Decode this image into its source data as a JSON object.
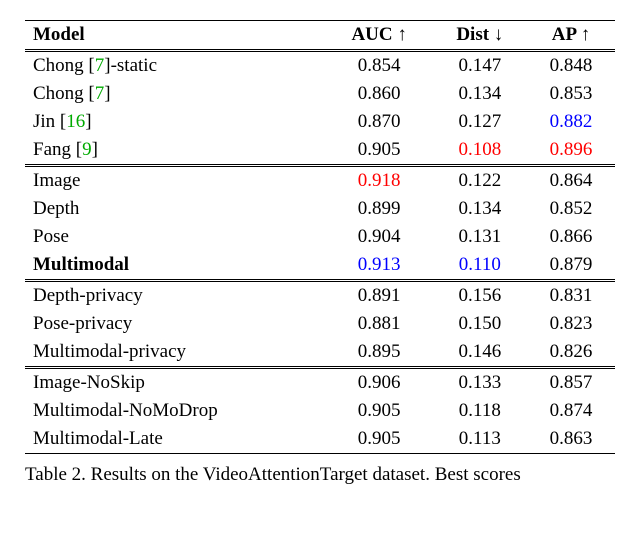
{
  "chart_data": {
    "type": "table",
    "title": "Table 2. Results on the VideoAttentionTarget dataset. Best scores",
    "columns": [
      "Model",
      "AUC ↑",
      "Dist ↓",
      "AP ↑"
    ],
    "groups": [
      {
        "rows": [
          {
            "model": "Chong [7]-static",
            "cite": "7",
            "model_prefix": "Chong [",
            "model_suffix": "]-static",
            "auc": "0.854",
            "dist": "0.147",
            "ap": "0.848"
          },
          {
            "model": "Chong [7]",
            "cite": "7",
            "model_prefix": "Chong [",
            "model_suffix": "]",
            "auc": "0.860",
            "dist": "0.134",
            "ap": "0.853"
          },
          {
            "model": "Jin [16]",
            "cite": "16",
            "model_prefix": "Jin [",
            "model_suffix": "]",
            "auc": "0.870",
            "dist": "0.127",
            "ap": "0.882",
            "ap_color": "blue"
          },
          {
            "model": "Fang [9]",
            "cite": "9",
            "model_prefix": "Fang [",
            "model_suffix": "]",
            "auc": "0.905",
            "dist": "0.108",
            "dist_color": "red",
            "ap": "0.896",
            "ap_color": "red"
          }
        ]
      },
      {
        "rows": [
          {
            "model": "Image",
            "auc": "0.918",
            "auc_color": "red",
            "dist": "0.122",
            "ap": "0.864"
          },
          {
            "model": "Depth",
            "auc": "0.899",
            "dist": "0.134",
            "ap": "0.852"
          },
          {
            "model": "Pose",
            "auc": "0.904",
            "dist": "0.131",
            "ap": "0.866"
          },
          {
            "model": "Multimodal",
            "model_bold": true,
            "auc": "0.913",
            "auc_color": "blue",
            "dist": "0.110",
            "dist_color": "blue",
            "ap": "0.879"
          }
        ]
      },
      {
        "rows": [
          {
            "model": "Depth-privacy",
            "auc": "0.891",
            "dist": "0.156",
            "ap": "0.831"
          },
          {
            "model": "Pose-privacy",
            "auc": "0.881",
            "dist": "0.150",
            "ap": "0.823"
          },
          {
            "model": "Multimodal-privacy",
            "auc": "0.895",
            "dist": "0.146",
            "ap": "0.826"
          }
        ]
      },
      {
        "rows": [
          {
            "model": "Image-NoSkip",
            "auc": "0.906",
            "dist": "0.133",
            "ap": "0.857"
          },
          {
            "model": "Multimodal-NoMoDrop",
            "auc": "0.905",
            "dist": "0.118",
            "ap": "0.874"
          },
          {
            "model": "Multimodal-Late",
            "auc": "0.905",
            "dist": "0.113",
            "ap": "0.863"
          }
        ]
      }
    ]
  },
  "caption": "Table 2. Results on the VideoAttentionTarget dataset. Best scores"
}
